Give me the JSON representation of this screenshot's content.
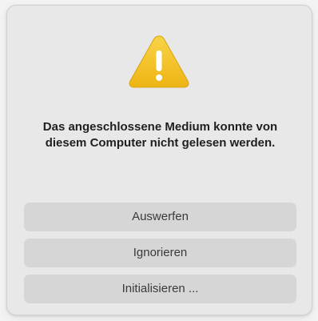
{
  "dialog": {
    "icon": "warning-triangle-icon",
    "message": "Das angeschlossene Medium konnte von diesem Computer nicht gelesen werden.",
    "buttons": [
      {
        "label": "Auswerfen"
      },
      {
        "label": "Ignorieren"
      },
      {
        "label": "Initialisieren ..."
      }
    ]
  },
  "colors": {
    "warning_fill": "#f2c01e",
    "warning_mark": "#ffffff",
    "button_bg": "#d6d6d6",
    "dialog_bg": "#e8e8e8"
  }
}
